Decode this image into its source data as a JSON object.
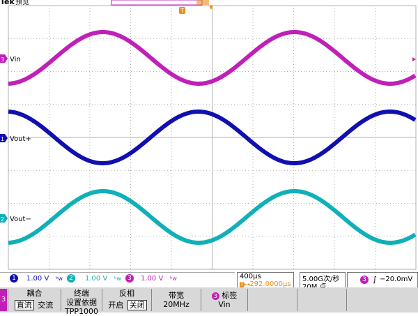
{
  "header": {
    "brand": "Tek",
    "mode": "预览",
    "trigger_marker": "T"
  },
  "channels": [
    {
      "label": "Vin",
      "color": "#c020b8",
      "number": "3"
    },
    {
      "label": "Vout+",
      "color": "#1010b0",
      "number": "1"
    },
    {
      "label": "Vout−",
      "color": "#10b0b8",
      "number": "2"
    }
  ],
  "readouts": {
    "ch1_num": "1",
    "ch1_scale": "1.00 V",
    "ch2_num": "2",
    "ch2_scale": "1.00 V",
    "ch3_num": "3",
    "ch3_scale": "1.00 V",
    "bw_symbol": "ᵇw",
    "timebase": "400μs",
    "trigger_pos": "292.0000μs",
    "sample_rate": "5.00G次/秒",
    "record_length": "20M 点",
    "trigger_ch": "3",
    "trigger_level": "−20.0mV"
  },
  "menu": {
    "ch_tab": "3",
    "coupling_title": "耦合",
    "coupling_dc": "直流",
    "coupling_ac": "交流",
    "term_title1": "终端",
    "term_title2": "设置依据",
    "term_value": "TPP1000",
    "invert_title": "反相",
    "invert_on": "开启",
    "invert_off": "关闭",
    "bw_title": "带宽",
    "bw_value": "20MHz",
    "label_num": "3",
    "label_title": "标签",
    "label_value": "Vin"
  },
  "colors": {
    "ch1": "#1010b0",
    "ch2": "#10b0b8",
    "ch3": "#c020b8",
    "trigger": "#e89020",
    "grid": "#b0b0b0"
  }
}
